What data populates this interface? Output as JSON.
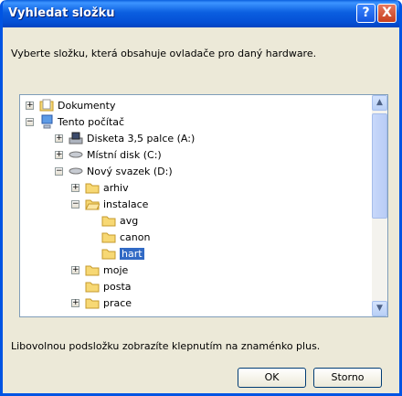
{
  "window": {
    "title": "Vyhledat složku",
    "help_label": "?",
    "close_label": "X"
  },
  "description": "Vyberte složku, která obsahuje ovladače pro daný hardware.",
  "tree": {
    "items": [
      {
        "label": "Dokumenty",
        "expander": "+",
        "icon": "folder-icon"
      },
      {
        "label": "Tento počítač",
        "expander": "−",
        "icon": "computer-icon"
      },
      {
        "label": "Disketa 3,5 palce (A:)",
        "expander": "+",
        "icon": "floppy-drive-icon"
      },
      {
        "label": "Místní disk (C:)",
        "expander": "+",
        "icon": "hard-drive-icon"
      },
      {
        "label": "Nový svazek (D:)",
        "expander": "−",
        "icon": "hard-drive-icon"
      },
      {
        "label": "arhiv",
        "expander": "+",
        "icon": "folder-icon"
      },
      {
        "label": "instalace",
        "expander": "−",
        "icon": "folder-open-icon"
      },
      {
        "label": "avg",
        "expander": "",
        "icon": "folder-icon"
      },
      {
        "label": "canon",
        "expander": "",
        "icon": "folder-icon"
      },
      {
        "label": "hart",
        "expander": "",
        "icon": "folder-icon",
        "selected": true
      },
      {
        "label": "moje",
        "expander": "+",
        "icon": "folder-icon"
      },
      {
        "label": "posta",
        "expander": "",
        "icon": "folder-icon"
      },
      {
        "label": "prace",
        "expander": "+",
        "icon": "folder-icon"
      }
    ]
  },
  "hint": "Libovolnou podsložku zobrazíte klepnutím na znaménko plus.",
  "buttons": {
    "ok": "OK",
    "cancel": "Storno"
  },
  "colors": {
    "titlebar": "#0a5fde",
    "selection": "#316ac5",
    "dialog_bg": "#ece9d8"
  }
}
